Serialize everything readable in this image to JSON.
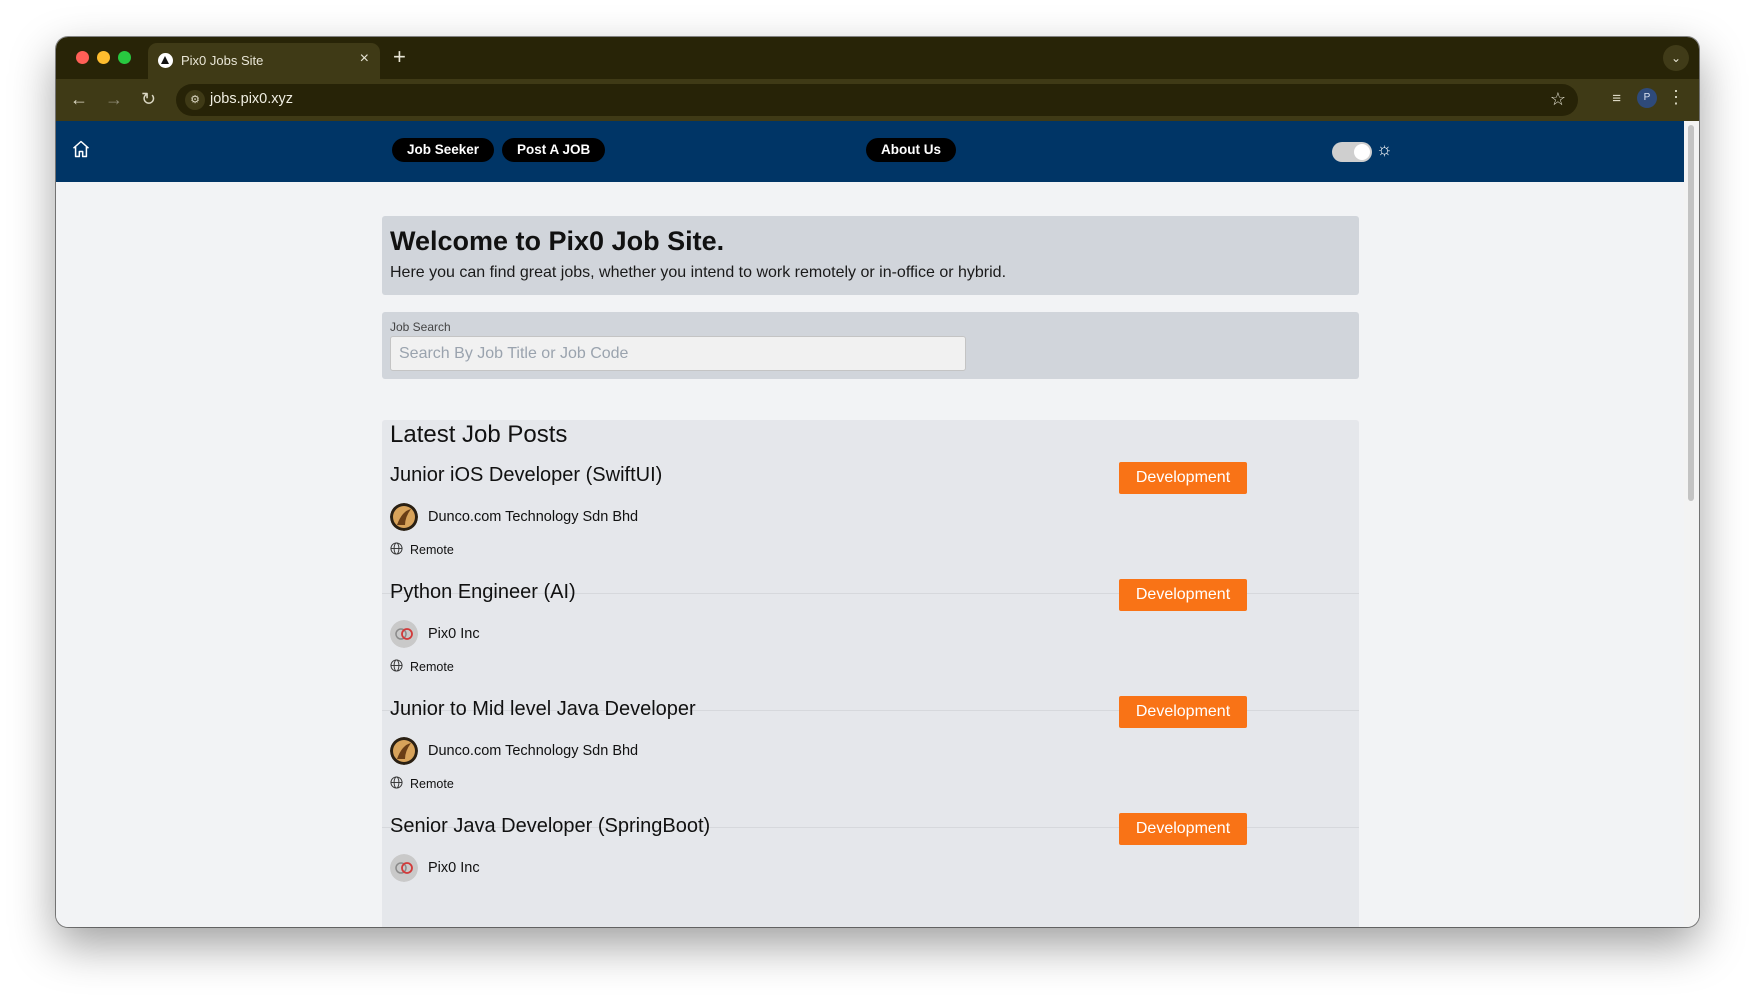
{
  "browser": {
    "tab_title": "Pix0 Jobs Site",
    "tab_close": "×",
    "new_tab": "+",
    "url": "jobs.pix0.xyz",
    "profile_initial": "P",
    "nav_back": "←",
    "nav_forward": "→",
    "nav_reload": "↻",
    "bookmark_star": "☆",
    "menu_dots": "⋮",
    "tab_menu": "⌄"
  },
  "navbar": {
    "job_seeker": "Job Seeker",
    "post_job": "Post A JOB",
    "about": "About Us",
    "theme_icon": "☼"
  },
  "hero": {
    "title": "Welcome to Pix0 Job Site.",
    "subtitle": "Here you can find great jobs, whether you intend to work remotely or in-office or hybrid."
  },
  "search": {
    "label": "Job Search",
    "placeholder": "Search By Job Title or Job Code"
  },
  "posts": {
    "title": "Latest Job Posts",
    "items": [
      {
        "title": "Junior iOS Developer (SwiftUI)",
        "company": "Dunco.com Technology Sdn Bhd",
        "location": "Remote",
        "category": "Development"
      },
      {
        "title": "Python Engineer (AI)",
        "company": "Pix0 Inc",
        "location": "Remote",
        "category": "Development"
      },
      {
        "title": "Junior to Mid level Java Developer",
        "company": "Dunco.com Technology Sdn Bhd",
        "location": "Remote",
        "category": "Development"
      },
      {
        "title": "Senior Java Developer (SpringBoot)",
        "company": "Pix0 Inc",
        "location": "",
        "category": "Development"
      }
    ]
  },
  "colors": {
    "navbar": "#003566",
    "badge": "#f97316",
    "browser_frame": "#282407"
  }
}
